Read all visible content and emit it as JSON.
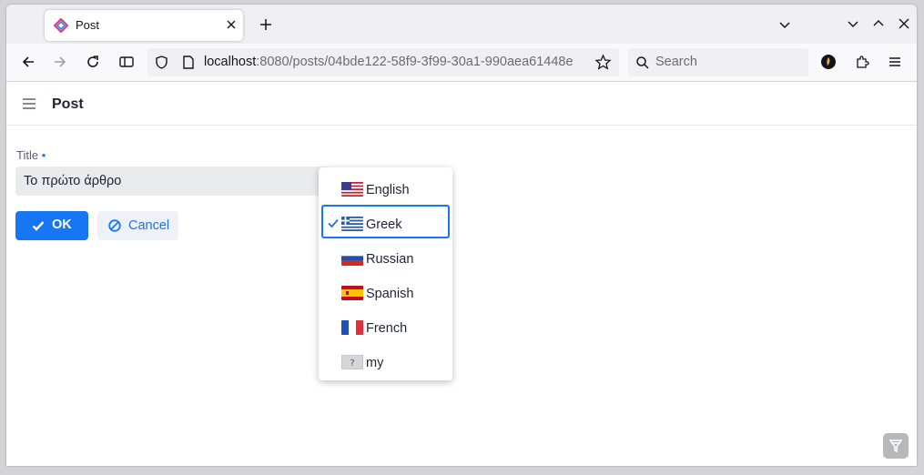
{
  "browser": {
    "tab_title": "Post",
    "url_host": "localhost",
    "url_rest": ":8080/posts/04bde122-58f9-3f99-30a1-990aea61448e",
    "search_placeholder": "Search"
  },
  "app": {
    "title": "Post"
  },
  "form": {
    "title_label": "Title",
    "required_marker": "•",
    "title_value": "Το πρώτο άρθρο",
    "ok_label": "OK",
    "cancel_label": "Cancel"
  },
  "language_menu": {
    "selected": "Greek",
    "items": [
      {
        "label": "English",
        "flag": "us-flag-icon"
      },
      {
        "label": "Greek",
        "flag": "greece-flag-icon"
      },
      {
        "label": "Russian",
        "flag": "russia-flag-icon"
      },
      {
        "label": "Spanish",
        "flag": "spain-flag-icon"
      },
      {
        "label": "French",
        "flag": "france-flag-icon"
      },
      {
        "label": "my",
        "flag": "unknown-flag-icon"
      }
    ]
  },
  "colors": {
    "accent": "#1676f3",
    "input_bg": "#e9ebee"
  }
}
